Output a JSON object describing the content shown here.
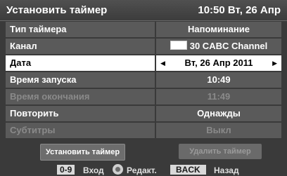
{
  "header": {
    "title": "Установить таймер",
    "clock": "10:50 Вт, 26 Апр"
  },
  "rows": [
    {
      "label": "Тип таймера",
      "value": "Напоминание"
    },
    {
      "label": "Канал",
      "value": "30 CABC Channel"
    },
    {
      "label": "Дата",
      "value": "Вт, 26 Апр 2011"
    },
    {
      "label": "Время запуска",
      "value": "10:49"
    },
    {
      "label": "Время окончания",
      "value": "11:49"
    },
    {
      "label": "Повторить",
      "value": "Однажды"
    },
    {
      "label": "Субтитры",
      "value": "Выкл"
    }
  ],
  "buttons": {
    "set_timer": "Установить таймер",
    "delete_timer": "Удалить таймер"
  },
  "footer": {
    "key_digits": "0-9",
    "digits_text": "Вход",
    "nav_text": "Редакт.",
    "key_back": "BACK",
    "back_text": "Назад"
  },
  "colors": {
    "background": "#3a3a3a",
    "row_bg": "#5a5a5a",
    "selected_bg": "#ffffff",
    "disabled_text": "#8a8a8a"
  }
}
